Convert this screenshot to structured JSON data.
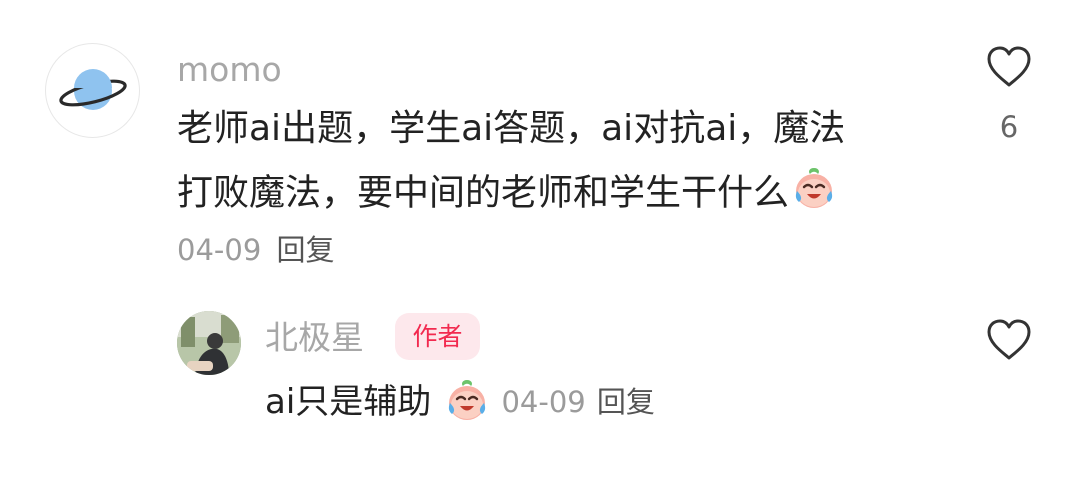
{
  "comments": [
    {
      "username": "momo",
      "text_line1": "老师ai出题，学生ai答题，ai对抗ai，魔法",
      "text_line2": "打败魔法，要中间的老师和学生干什么",
      "date": "04-09",
      "reply_label": "回复",
      "like_count": "6",
      "avatar_icon": "planet-icon",
      "emoji_icon": "crying-laughing-emoji-icon"
    },
    {
      "username": "北极星",
      "author_badge": "作者",
      "text": "ai只是辅助",
      "date": "04-09",
      "reply_label": "回复",
      "like_count": "",
      "emoji_icon": "crying-laughing-emoji-icon"
    }
  ],
  "colors": {
    "username": "#a7a7a7",
    "text": "#222222",
    "meta": "#9b9b9b",
    "badge_bg": "#fde8ec",
    "badge_text": "#f22a4f",
    "planet": "#8fc3ef"
  }
}
